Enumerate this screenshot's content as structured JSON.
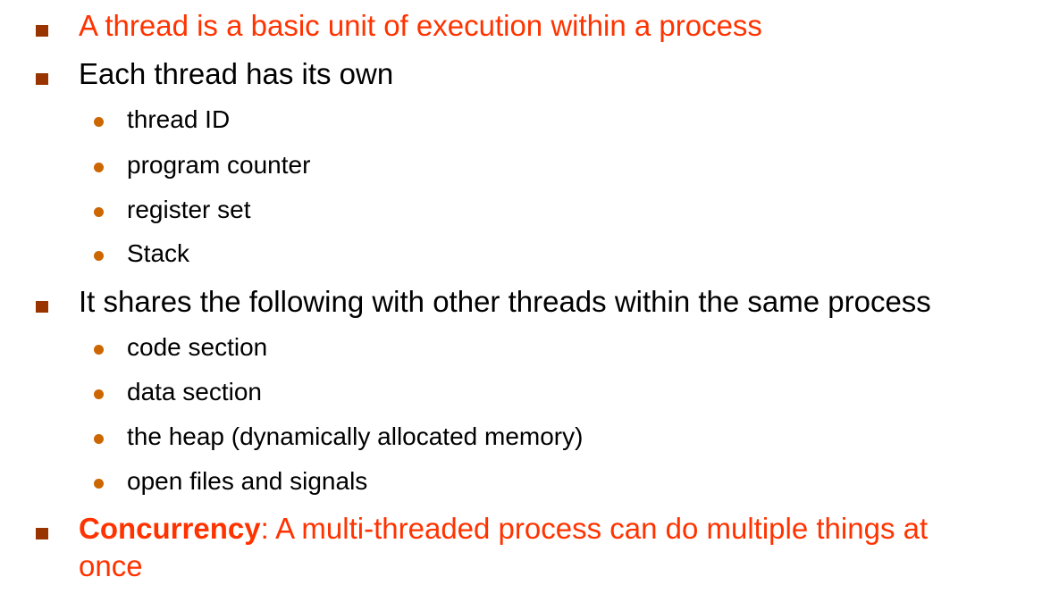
{
  "colors": {
    "level1_bullet": "#993300",
    "level2_bullet": "#cc6600",
    "highlight_text": "#ff3300",
    "body_text": "#000000"
  },
  "bullets": {
    "definition": "A thread is a basic unit of execution within a process",
    "own": {
      "text": "Each thread has its own",
      "items": [
        "thread ID",
        "program counter",
        "register set",
        "Stack"
      ]
    },
    "shares": {
      "text": "It shares the following with other threads within the same process",
      "items": [
        "code section",
        "data section",
        "the heap (dynamically allocated memory)",
        "open files and signals"
      ]
    },
    "concurrency": {
      "term": "Concurrency",
      "text_line1": ": A multi-threaded process can do multiple things at",
      "text_line2": "once"
    }
  }
}
